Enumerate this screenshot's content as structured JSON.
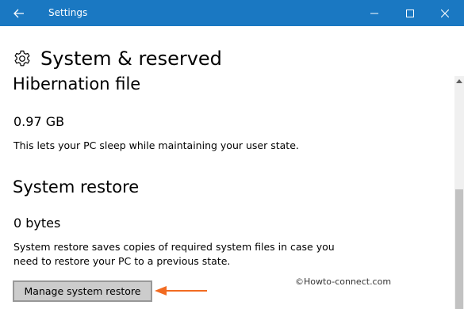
{
  "window": {
    "title": "Settings",
    "titlebar_color": "#1a78c2"
  },
  "icons": {
    "back": "back-arrow-icon",
    "settings": "gear-icon",
    "minimize": "minimize-icon",
    "maximize": "maximize-icon",
    "close": "close-icon"
  },
  "page": {
    "title": "System & reserved"
  },
  "hibernation": {
    "heading": "Hibernation file",
    "size": "0.97 GB",
    "description": "This lets your PC sleep while maintaining your user state."
  },
  "system_restore": {
    "heading": "System restore",
    "size": "0 bytes",
    "description_line1": "System restore saves copies of required system files in case you",
    "description_line2": "need to restore your PC to a previous state.",
    "button_label": "Manage system restore"
  },
  "annotation": {
    "arrow_color": "#f26b21",
    "watermark": "©Howto-connect.com"
  }
}
